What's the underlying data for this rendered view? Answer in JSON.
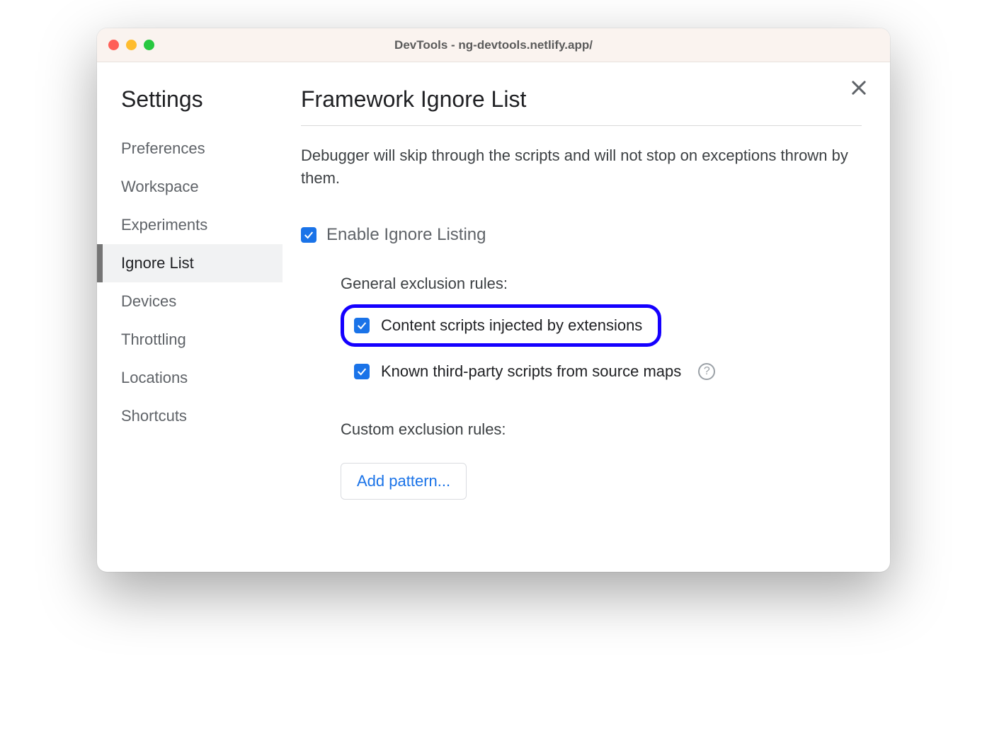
{
  "window_title": "DevTools - ng-devtools.netlify.app/",
  "sidebar": {
    "title": "Settings",
    "items": [
      {
        "label": "Preferences",
        "active": false
      },
      {
        "label": "Workspace",
        "active": false
      },
      {
        "label": "Experiments",
        "active": false
      },
      {
        "label": "Ignore List",
        "active": true
      },
      {
        "label": "Devices",
        "active": false
      },
      {
        "label": "Throttling",
        "active": false
      },
      {
        "label": "Locations",
        "active": false
      },
      {
        "label": "Shortcuts",
        "active": false
      }
    ]
  },
  "main": {
    "title": "Framework Ignore List",
    "description": "Debugger will skip through the scripts and will not stop on exceptions thrown by them.",
    "enable_label": "Enable Ignore Listing",
    "enable_checked": true,
    "general_rules_label": "General exclusion rules:",
    "rules": [
      {
        "label": "Content scripts injected by extensions",
        "checked": true,
        "highlighted": true,
        "help": false
      },
      {
        "label": "Known third-party scripts from source maps",
        "checked": true,
        "highlighted": false,
        "help": true
      }
    ],
    "custom_rules_label": "Custom exclusion rules:",
    "add_pattern_label": "Add pattern..."
  }
}
